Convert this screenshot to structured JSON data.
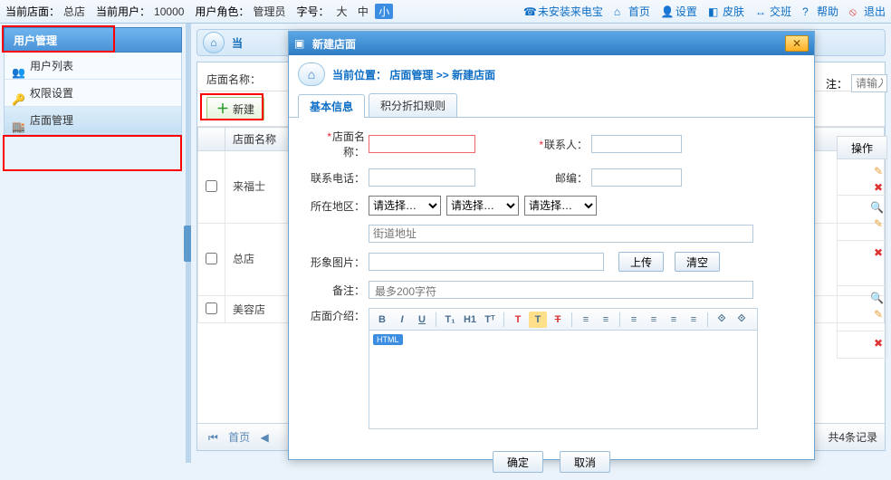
{
  "topbar": {
    "store_label": "当前店面：",
    "store_value": "总店",
    "user_label": "当前用户：",
    "user_value": "10000",
    "role_label": "用户角色：",
    "role_value": "管理员",
    "font_label": "字号：",
    "font_big": "大",
    "font_mid": "中",
    "font_small": "小",
    "phone_notice": "未安装来电宝",
    "links": {
      "home": "首页",
      "settings": "设置",
      "skin": "皮肤",
      "shift": "交班",
      "help": "帮助",
      "exit": "退出"
    }
  },
  "sidebar": {
    "header": "用户管理",
    "items": [
      {
        "label": "用户列表"
      },
      {
        "label": "权限设置"
      },
      {
        "label": "店面管理"
      }
    ]
  },
  "content": {
    "crumb_prefix": "当",
    "filter_label": "店面名称：",
    "new_btn": "新建",
    "col_name": "店面名称",
    "col_ops": "操作",
    "rows": [
      {
        "name": "来福士"
      },
      {
        "name": "总店"
      },
      {
        "name": "美容店"
      }
    ],
    "pager_first": "首页",
    "pager_total": "共4条记录",
    "remark_label": "注：",
    "remark_placeholder": "请输入"
  },
  "modal": {
    "title": "新建店面",
    "crumb_prefix": "当前位置：",
    "crumb_parent": "店面管理",
    "crumb_sep": " >> ",
    "crumb_current": "新建店面",
    "tabs": {
      "basic": "基本信息",
      "rules": "积分折扣规则"
    },
    "labels": {
      "store_name": "店面名称：",
      "contact": "联系人：",
      "phone": "联系电话：",
      "zip": "邮编：",
      "region": "所在地区：",
      "street_placeholder": "街道地址",
      "image": "形象图片：",
      "upload": "上传",
      "clear": "清空",
      "remark": "备注：",
      "remark_placeholder": "最多200字符",
      "intro": "店面介绍："
    },
    "region_option": "请选择…",
    "rte": {
      "bold": "B",
      "italic": "I",
      "underline": "U",
      "t1": "T₁",
      "h1": "H1",
      "t2": "Tᵀ",
      "color": "T",
      "bg": "T",
      "erase": "T",
      "ol": "≡",
      "ul": "≡",
      "al": "≡",
      "ac": "≡",
      "ar": "≡",
      "aj": "≡",
      "link": "⟐",
      "unlink": "⟐",
      "badge": "HTML"
    },
    "footer": {
      "ok": "确定",
      "cancel": "取消"
    }
  }
}
